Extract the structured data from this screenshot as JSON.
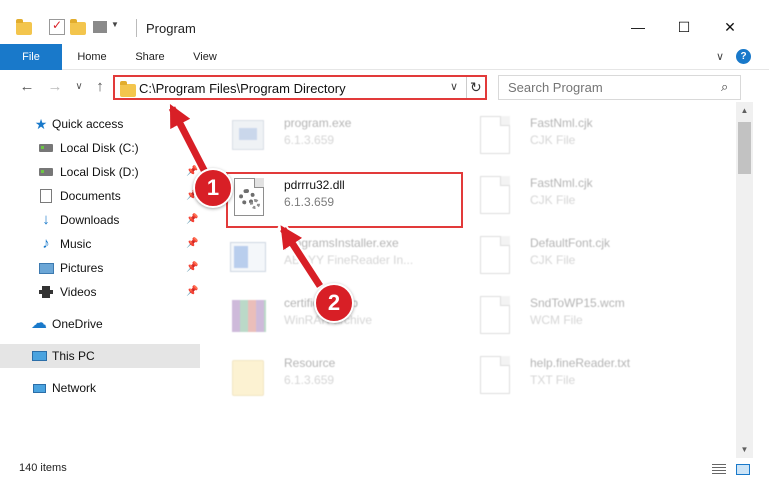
{
  "window": {
    "title": "Program",
    "minimize_glyph": "—",
    "maximize_glyph": "☐",
    "close_glyph": "✕"
  },
  "ribbon": {
    "file_tab": "File",
    "home_tab": "Home",
    "share_tab": "Share",
    "view_tab": "View",
    "expand_glyph": "∨",
    "help_glyph": "?"
  },
  "nav": {
    "back_glyph": "←",
    "forward_glyph": "→",
    "recent_glyph": "∨",
    "up_glyph": "↑",
    "address_path": "C:\\Program Files\\Program Directory",
    "address_chevron": "∨",
    "refresh_glyph": "↻"
  },
  "search": {
    "placeholder": "Search Program",
    "icon_glyph": "⌕"
  },
  "sidebar": {
    "items": [
      {
        "label": "Quick access",
        "icon": "star-icon"
      },
      {
        "label": "Local Disk (C:)",
        "icon": "disk-icon",
        "pinned": true
      },
      {
        "label": "Local Disk (D:)",
        "icon": "disk-icon",
        "pinned": true
      },
      {
        "label": "Documents",
        "icon": "documents-icon",
        "pinned": true
      },
      {
        "label": "Downloads",
        "icon": "download-arrow-icon",
        "pinned": true
      },
      {
        "label": "Music",
        "icon": "music-note-icon",
        "pinned": true
      },
      {
        "label": "Pictures",
        "icon": "pictures-icon",
        "pinned": true
      },
      {
        "label": "Videos",
        "icon": "video-film-icon",
        "pinned": true
      },
      {
        "label": "OneDrive",
        "icon": "cloud-icon"
      },
      {
        "label": "This PC",
        "icon": "computer-icon",
        "selected": true
      },
      {
        "label": "Network",
        "icon": "network-icon"
      }
    ],
    "pin_glyph": "📌"
  },
  "files": {
    "left": [
      {
        "name": "program.exe",
        "meta": "6.1.3.659",
        "icon": "exe-icon"
      },
      {
        "name": "pdrrru32.dll",
        "meta": "6.1.3.659",
        "icon": "dll-gear-icon",
        "highlighted": true
      },
      {
        "name": "programsInstaller.exe",
        "meta": "ABBYY FineReader In...",
        "icon": "installer-icon"
      },
      {
        "name": "certificate.cab",
        "meta": "WinRAR archive",
        "icon": "cab-archive-icon"
      },
      {
        "name": "Resource",
        "meta": "6.1.3.659",
        "icon": "folder-icon"
      }
    ],
    "right": [
      {
        "name": "FastNml.cjk",
        "meta": "CJK File",
        "icon": "blank-file-icon"
      },
      {
        "name": "FastNml.cjk",
        "meta": "CJK File",
        "icon": "blank-file-icon"
      },
      {
        "name": "DefaultFont.cjk",
        "meta": "CJK File",
        "icon": "blank-file-icon"
      },
      {
        "name": "SndToWP15.wcm",
        "meta": "WCM File",
        "icon": "blank-file-icon"
      },
      {
        "name": "help.fineReader.txt",
        "meta": "TXT File",
        "icon": "blank-file-icon"
      }
    ]
  },
  "scrollbar": {
    "up_glyph": "▲",
    "down_glyph": "▼"
  },
  "status": {
    "item_count": "140 items"
  },
  "annotations": {
    "step1": "1",
    "step2": "2"
  },
  "colors": {
    "accent": "#1979ca",
    "annotation_red": "#d81f26",
    "highlight_border": "#e23a3a",
    "selected_row": "#e5e5e5"
  }
}
